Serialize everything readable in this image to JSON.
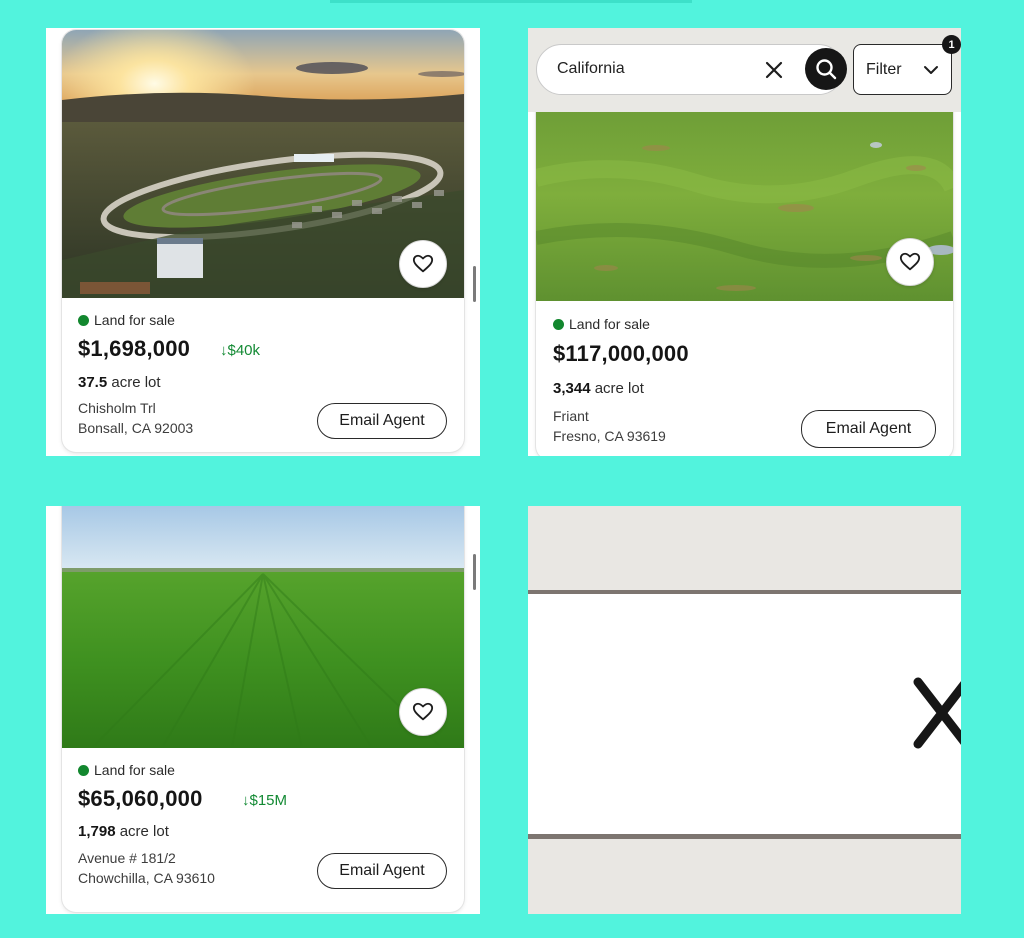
{
  "listings": [
    {
      "status": "Land for sale",
      "price": "$1,698,000",
      "price_drop": "↓$40k",
      "acres": "37.5",
      "lot_suffix": " acre lot",
      "street": "Chisholm Trl",
      "city": "Bonsall, CA 92003",
      "cta": "Email Agent"
    },
    {
      "status": "Land for sale",
      "price": "$117,000,000",
      "price_drop": "",
      "acres": "3,344",
      "lot_suffix": " acre lot",
      "street": "Friant",
      "city": "Fresno, CA 93619",
      "cta": "Email Agent"
    },
    {
      "status": "Land for sale",
      "price": "$65,060,000",
      "price_drop": "↓$15M",
      "acres": "1,798",
      "lot_suffix": " acre lot",
      "street": "Avenue # 181/2",
      "city": "Chowchilla, CA 93610",
      "cta": "Email Agent"
    }
  ],
  "search": {
    "value": "California",
    "filter_label": "Filter",
    "filter_count": "1"
  },
  "icons": {
    "favorite": "heart-outline-icon",
    "search": "magnifier-icon",
    "clear": "close-icon",
    "dropdown": "chevron-down-icon"
  },
  "colors": {
    "background": "#52f3dd",
    "status_dot": "#12872e",
    "price_drop": "#138a34",
    "dark_button": "#161616"
  }
}
